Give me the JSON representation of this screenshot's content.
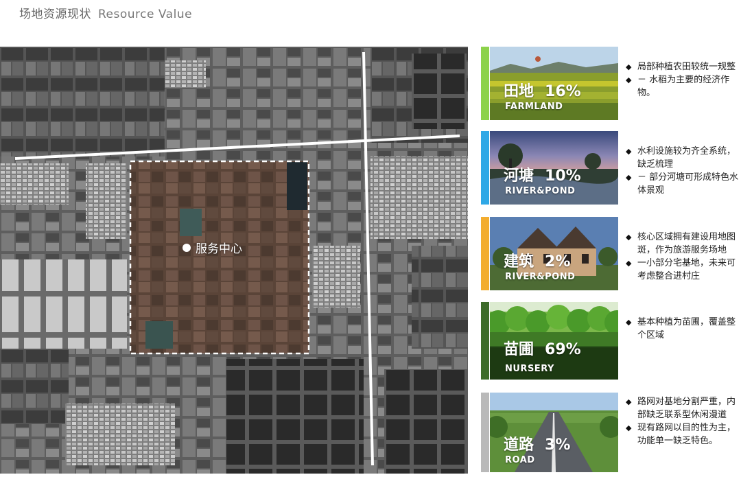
{
  "header": {
    "title_cn": "场地资源现状",
    "title_en": "Resource Value"
  },
  "map": {
    "marker_label": "服务中心"
  },
  "cards": [
    {
      "name_cn": "田地",
      "percent": "16%",
      "name_en": "FARMLAND",
      "bar_color": "#8cd24a",
      "bullets": [
        "局部种植农田较统一规整",
        "－ 水稻为主要的经济作物。"
      ]
    },
    {
      "name_cn": "河塘",
      "percent": "10%",
      "name_en": "RIVER&POND",
      "bar_color": "#2fa8e6",
      "bullets": [
        "水利设施较为齐全系统，缺乏梳理",
        "－ 部分河塘可形成特色水体景观"
      ]
    },
    {
      "name_cn": "建筑",
      "percent": "2%",
      "name_en": "RIVER&POND",
      "bar_color": "#f3ad2f",
      "bullets": [
        "核心区域拥有建设用地图斑，作为旅游服务场地",
        "一小部分宅基地，未来可考虑整合进村庄"
      ]
    },
    {
      "name_cn": "苗圃",
      "percent": "69%",
      "name_en": "NURSERY",
      "bar_color": "#3d6b2a",
      "bullets": [
        "基本种植为苗圃，覆盖整个区域"
      ]
    },
    {
      "name_cn": "道路",
      "percent": "3%",
      "name_en": "ROAD",
      "bar_color": "#b9b9b9",
      "bullets": [
        "路网对基地分割严重，内部缺乏联系型休闲漫道",
        "现有路网以目的性为主， 功能单一缺乏特色。"
      ]
    }
  ]
}
